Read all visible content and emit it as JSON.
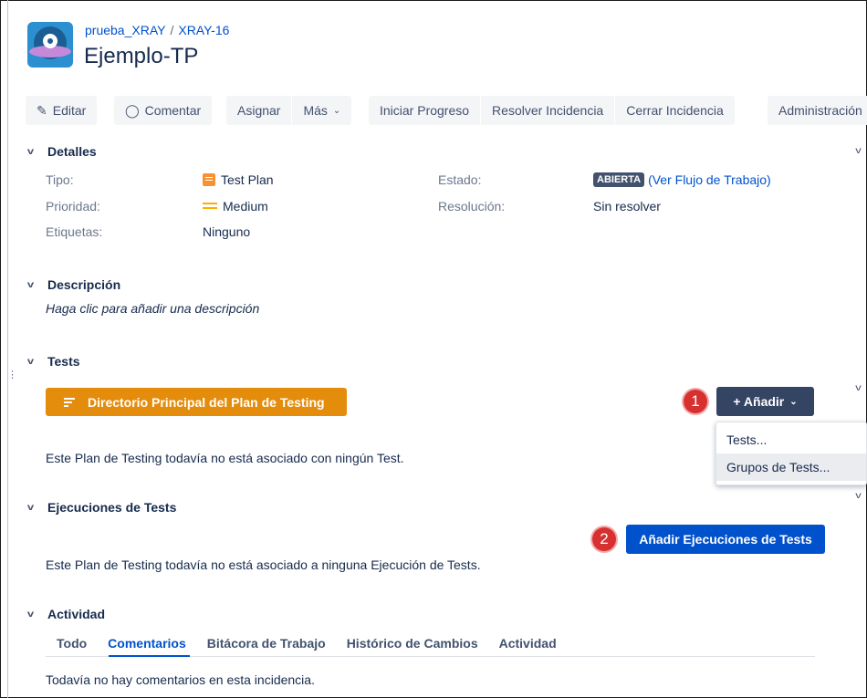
{
  "header": {
    "project_link": "prueba_XRAY",
    "separator": "/",
    "issue_key": "XRAY-16",
    "title": "Ejemplo-TP"
  },
  "toolbar": {
    "edit": "Editar",
    "comment": "Comentar",
    "assign": "Asignar",
    "more": "Más",
    "start_progress": "Iniciar Progreso",
    "resolve": "Resolver Incidencia",
    "close": "Cerrar Incidencia",
    "admin": "Administración"
  },
  "details": {
    "section_title": "Detalles",
    "type_label": "Tipo:",
    "type_value": "Test Plan",
    "priority_label": "Prioridad:",
    "priority_value": "Medium",
    "labels_label": "Etiquetas:",
    "labels_value": "Ninguno",
    "status_label": "Estado:",
    "status_lozenge": "ABIERTA",
    "workflow_link": "(Ver Flujo de Trabajo)",
    "resolution_label": "Resolución:",
    "resolution_value": "Sin resolver"
  },
  "description": {
    "section_title": "Descripción",
    "placeholder": "Haga clic para añadir una descripción"
  },
  "tests": {
    "section_title": "Tests",
    "directory_button": "Directorio Principal del Plan de Testing",
    "badge_1": "1",
    "add_button": "+ Añadir",
    "dropdown_items": [
      "Tests...",
      "Grupos de Tests..."
    ],
    "empty_message": "Este Plan de Testing todavía no está asociado con ningún Test."
  },
  "executions": {
    "section_title": "Ejecuciones de Tests",
    "badge_2": "2",
    "add_button": "Añadir Ejecuciones de Tests",
    "empty_message": "Este Plan de Testing todavía no está asociado a ninguna Ejecución de Tests."
  },
  "activity": {
    "section_title": "Actividad",
    "tabs": [
      "Todo",
      "Comentarios",
      "Bitácora de Trabajo",
      "Histórico de Cambios",
      "Actividad"
    ],
    "empty_message": "Todavía no hay comentarios en esta incidencia."
  },
  "colors": {
    "link_blue": "#0052cc",
    "orange": "#e48d0c",
    "dark_button": "#344563",
    "badge_red": "#d63031"
  }
}
